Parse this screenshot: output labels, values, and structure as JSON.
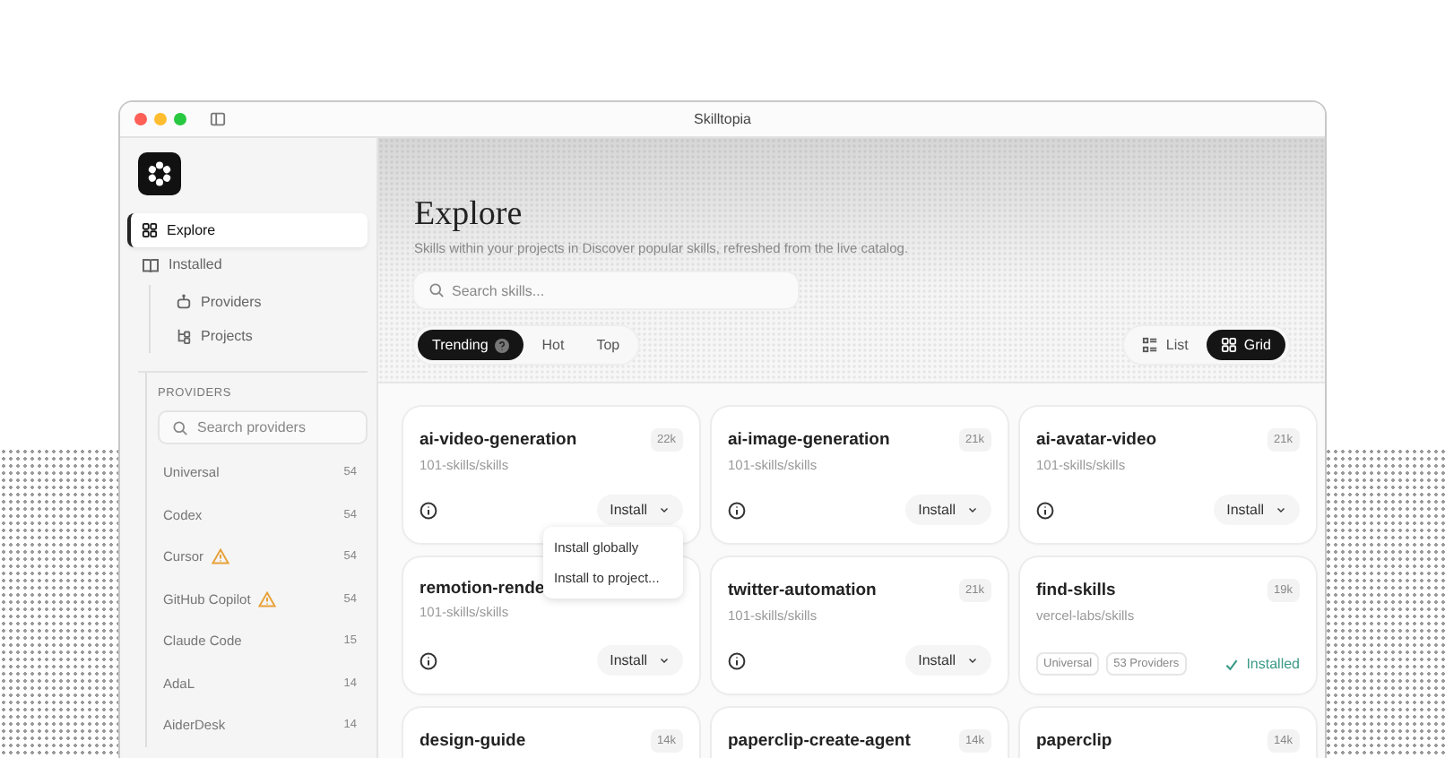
{
  "window": {
    "title": "Skilltopia"
  },
  "sidebar": {
    "nav": [
      {
        "label": "Explore",
        "selected": true
      },
      {
        "label": "Installed",
        "selected": false,
        "children": [
          {
            "label": "Providers",
            "selected": false
          },
          {
            "label": "Projects",
            "selected": false
          }
        ]
      }
    ],
    "providers": {
      "title": "PROVIDERS",
      "search": {
        "placeholder": "Search providers"
      },
      "items": [
        {
          "name": "Universal",
          "count": "54",
          "warning": false
        },
        {
          "name": "Codex",
          "count": "54",
          "warning": false
        },
        {
          "name": "Cursor",
          "count": "54",
          "warning": true
        },
        {
          "name": "GitHub Copilot",
          "count": "54",
          "warning": true
        },
        {
          "name": "Claude Code",
          "count": "15",
          "warning": false
        },
        {
          "name": "AdaL",
          "count": "14",
          "warning": false
        },
        {
          "name": "AiderDesk",
          "count": "14",
          "warning": false
        }
      ]
    }
  },
  "main": {
    "title": "Explore",
    "subtitle": "Skills within your projects in Discover popular skills, refreshed from the live catalog.",
    "search": {
      "placeholder": "Search skills..."
    },
    "filters": [
      {
        "label": "Trending",
        "selected": true,
        "help": true
      },
      {
        "label": "Hot",
        "selected": false,
        "help": false
      },
      {
        "label": "Top",
        "selected": false,
        "help": false
      }
    ],
    "views": [
      {
        "label": "List",
        "selected": false
      },
      {
        "label": "Grid",
        "selected": true
      }
    ],
    "cards": [
      {
        "name": "ai-video-generation",
        "count": "22k",
        "source": "101-skills/skills",
        "kind": "install",
        "button": "Install",
        "menu": [
          "Install globally",
          "Install to project..."
        ]
      },
      {
        "name": "ai-image-generation",
        "count": "21k",
        "source": "101-skills/skills",
        "kind": "install",
        "button": "Install"
      },
      {
        "name": "ai-avatar-video",
        "count": "21k",
        "source": "101-skills/skills",
        "kind": "install",
        "button": "Install"
      },
      {
        "name": "remotion-rende",
        "source": "101-skills/skills",
        "kind": "install",
        "button": "Install"
      },
      {
        "name": "twitter-automation",
        "count": "21k",
        "source": "101-skills/skills",
        "kind": "install",
        "button": "Install"
      },
      {
        "name": "find-skills",
        "count": "19k",
        "source": "vercel-labs/skills",
        "kind": "installed",
        "tags": [
          "Universal",
          "53 Providers"
        ],
        "status": "Installed"
      },
      {
        "name": "design-guide",
        "count": "14k"
      },
      {
        "name": "paperclip-create-agent",
        "count": "14k"
      },
      {
        "name": "paperclip",
        "count": "14k"
      }
    ]
  }
}
